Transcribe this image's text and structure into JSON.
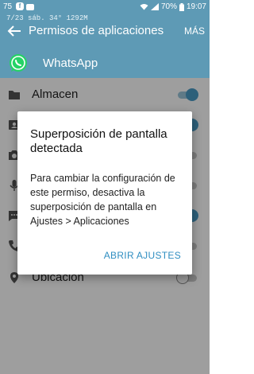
{
  "status_bar": {
    "notification_count": "75",
    "badge_letter": "f",
    "battery": "70%",
    "time": "19:07"
  },
  "overlay_info": "7/23  sáb.   34°   1292M",
  "header": {
    "title": "Permisos de aplicaciones",
    "more": "MÁS"
  },
  "app": {
    "name": "WhatsApp"
  },
  "permissions": [
    {
      "label": "Almacen",
      "icon": "folder-icon",
      "enabled": true
    },
    {
      "label": "",
      "icon": "contacts-icon",
      "enabled": true
    },
    {
      "label": "",
      "icon": "camera-icon",
      "enabled": false
    },
    {
      "label": "",
      "icon": "microphone-icon",
      "enabled": false
    },
    {
      "label": "",
      "icon": "sms-icon",
      "enabled": true
    },
    {
      "label": "",
      "icon": "phone-icon",
      "enabled": false
    },
    {
      "label": "Ubicación",
      "icon": "location-icon",
      "enabled": false
    }
  ],
  "dialog": {
    "title": "Superposición de pantalla detectada",
    "body": "Para cambiar la configuración de este permiso, desactiva la superposición de pantalla en Ajustes > Aplicaciones",
    "action": "ABRIR AJUSTES"
  },
  "colors": {
    "header": "#5e9ab5",
    "toggle_on": "#4a9cc6",
    "action": "#2f8ec1",
    "whatsapp": "#25d366"
  }
}
